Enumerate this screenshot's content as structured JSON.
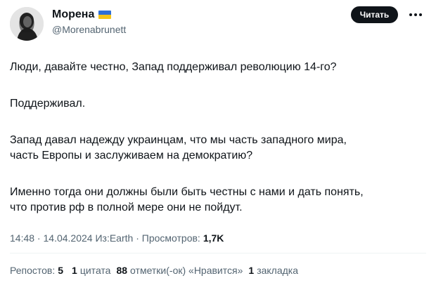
{
  "author": {
    "display_name": "Морена",
    "handle": "@Morenabrunett",
    "flag_icon": "ukraine-flag-icon",
    "flag_colors": [
      "#2f6fd6",
      "#f5c518"
    ]
  },
  "header": {
    "follow_label": "Читать",
    "more_icon": "more-dots-icon"
  },
  "tweet": {
    "lines": [
      "Люди, давайте честно, Запад поддерживал революцию 14-го?",
      "Поддерживал.",
      "Запад давал надежду украинцам, что мы часть западного мира,",
      "часть Европы и заслуживаем на демократию?",
      "Именно тогда они должны были быть честны с нами и дать понять,",
      "что против рф в полной мере они не пойдут."
    ]
  },
  "meta": {
    "time": "14:48",
    "date": "14.04.2024",
    "source": "Из:Earth",
    "views_label": "Просмотров:",
    "views_count": "1,7K"
  },
  "stats": {
    "reposts_label": "Репостов:",
    "reposts_count": "5",
    "quotes_count": "1",
    "quotes_label": "цитата",
    "likes_count": "88",
    "likes_label": "отметки(-ок) «Нравится»",
    "bookmarks_count": "1",
    "bookmarks_label": "закладка"
  },
  "colors": {
    "text_primary": "#0f1419",
    "text_secondary": "#536471",
    "button_bg": "#0f1419",
    "divider": "#eff3f4"
  }
}
